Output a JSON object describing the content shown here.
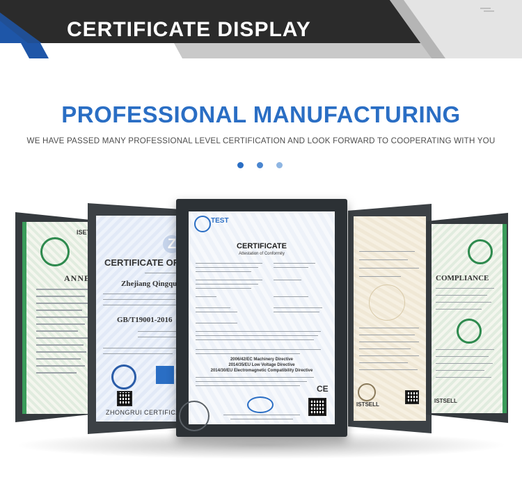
{
  "banner": {
    "title": "CERTIFICATE DISPLAY",
    "accent_color": "#1f56a8",
    "dark_color": "#4a4a4a",
    "light_color": "#c9c9c9"
  },
  "headline": {
    "title": "PROFESSIONAL MANUFACTURING",
    "subtitle": "WE HAVE PASSED MANY PROFESSIONAL LEVEL CERTIFICATION AND LOOK FORWARD TO COOPERATING WITH YOU",
    "title_color": "#2a6ec4"
  },
  "carousel_dots": [
    {
      "color": "#2a6ec4"
    },
    {
      "color": "#4a86d0"
    },
    {
      "color": "#8fb6e3"
    }
  ],
  "certificates": {
    "far_left": {
      "heading": "ANNE",
      "label": "ISET"
    },
    "left": {
      "heading": "CERTIFICATE OF",
      "company": "Zhejiang Qingquan",
      "standard": "GB/T19001-2016",
      "footer": "ZHONGRUI CERTIFICATION"
    },
    "center": {
      "logo": "TEST",
      "heading": "CERTIFICATE",
      "subheading": "Attestation of Conformity",
      "directives": [
        "2006/42/EC Machinery Directive",
        "2014/35/EU Low Voltage Directive",
        "2014/30/EU Electromagnetic Compatibility Directive"
      ],
      "ce_mark": "CE"
    },
    "right": {
      "label": "ISTSELL"
    },
    "far_right": {
      "heading": "COMPLIANCE",
      "label": "ISTSELL"
    }
  }
}
